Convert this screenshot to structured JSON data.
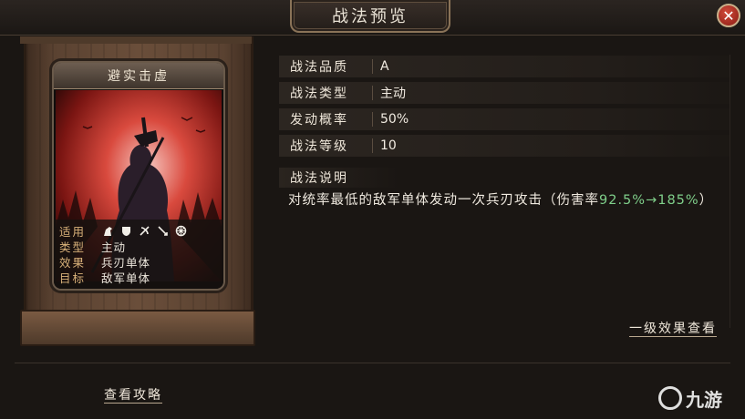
{
  "window": {
    "title": "战法预览",
    "close_icon": "close-icon"
  },
  "skill_card": {
    "name": "避实击虚",
    "stats": [
      {
        "label": "适用",
        "icons": [
          "cavalry-icon",
          "shield-icon",
          "bow-icon",
          "spear-icon",
          "chariot-icon"
        ]
      },
      {
        "label": "类型",
        "value": "主动"
      },
      {
        "label": "效果",
        "value": "兵刃单体"
      },
      {
        "label": "目标",
        "value": "敌军单体"
      }
    ]
  },
  "info": {
    "rows": [
      {
        "label": "战法品质",
        "value": "A"
      },
      {
        "label": "战法类型",
        "value": "主动"
      },
      {
        "label": "发动概率",
        "value": "50%"
      },
      {
        "label": "战法等级",
        "value": "10"
      }
    ],
    "description_title": "战法说明",
    "description_prefix": "对统率最低的敌军单体发动一次兵刃攻击（伤害率",
    "description_highlight": "92.5%→185%",
    "description_suffix": "）",
    "highlight_color": "#7fcf8a"
  },
  "links": {
    "level1_effects": "一级效果查看",
    "strategy_guide": "查看攻略"
  },
  "watermark": {
    "text": "九游"
  }
}
